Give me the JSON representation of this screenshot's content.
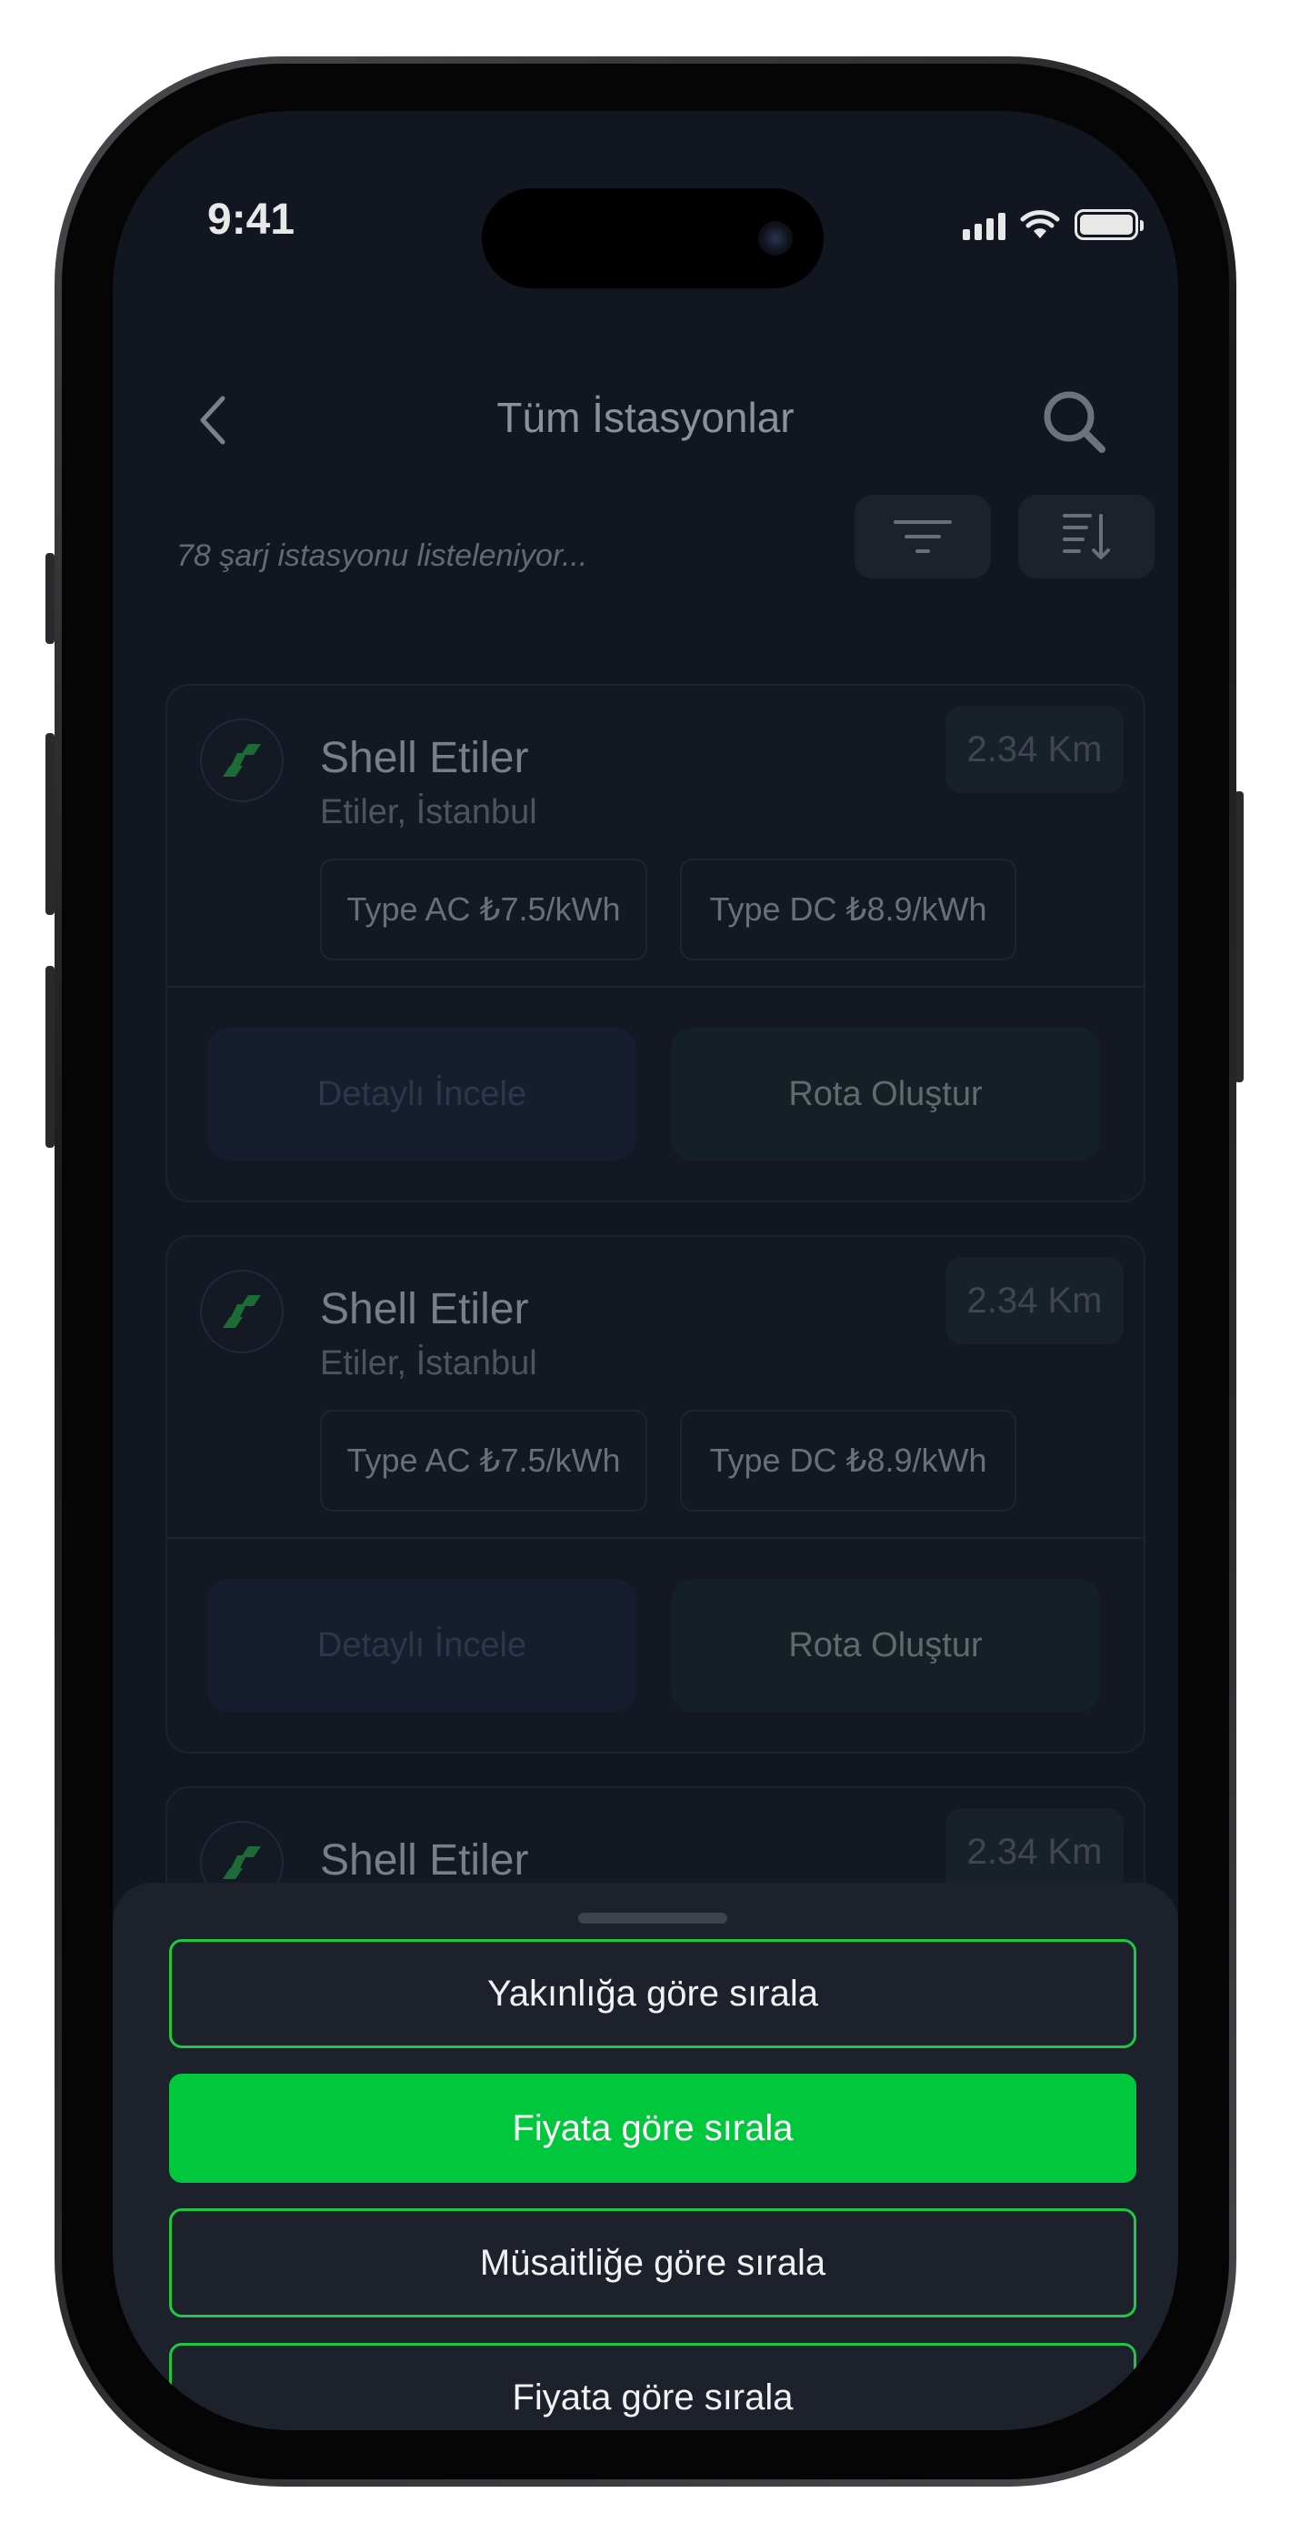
{
  "status_bar": {
    "time": "9:41"
  },
  "header": {
    "title": "Tüm İstasyonlar"
  },
  "toolbar": {
    "count_text": "78 şarj istasyonu listeleniyor..."
  },
  "stations": [
    {
      "name": "Shell Etiler",
      "location": "Etiler, İstanbul",
      "distance": "2.34 Km",
      "tags": [
        "Type AC ₺7.5/kWh",
        "Type DC ₺8.9/kWh"
      ],
      "detail_label": "Detaylı İncele",
      "route_label": "Rota Oluştur"
    },
    {
      "name": "Shell Etiler",
      "location": "Etiler, İstanbul",
      "distance": "2.34 Km",
      "tags": [
        "Type AC ₺7.5/kWh",
        "Type DC ₺8.9/kWh"
      ],
      "detail_label": "Detaylı İncele",
      "route_label": "Rota Oluştur"
    },
    {
      "name": "Shell Etiler",
      "distance": "2.34 Km"
    }
  ],
  "sort_sheet": {
    "options": [
      {
        "label": "Yakınlığa göre sırala",
        "selected": false
      },
      {
        "label": "Fiyata göre sırala",
        "selected": true
      },
      {
        "label": "Müsaitliğe göre sırala",
        "selected": false
      },
      {
        "label": "Fiyata göre sırala",
        "selected": false
      }
    ]
  },
  "colors": {
    "accent": "#00C73C",
    "background": "#121620",
    "sheet": "#1C212B"
  },
  "icons": [
    "back-chevron-icon",
    "search-icon",
    "filter-icon",
    "sort-icon",
    "charging-station-icon"
  ]
}
